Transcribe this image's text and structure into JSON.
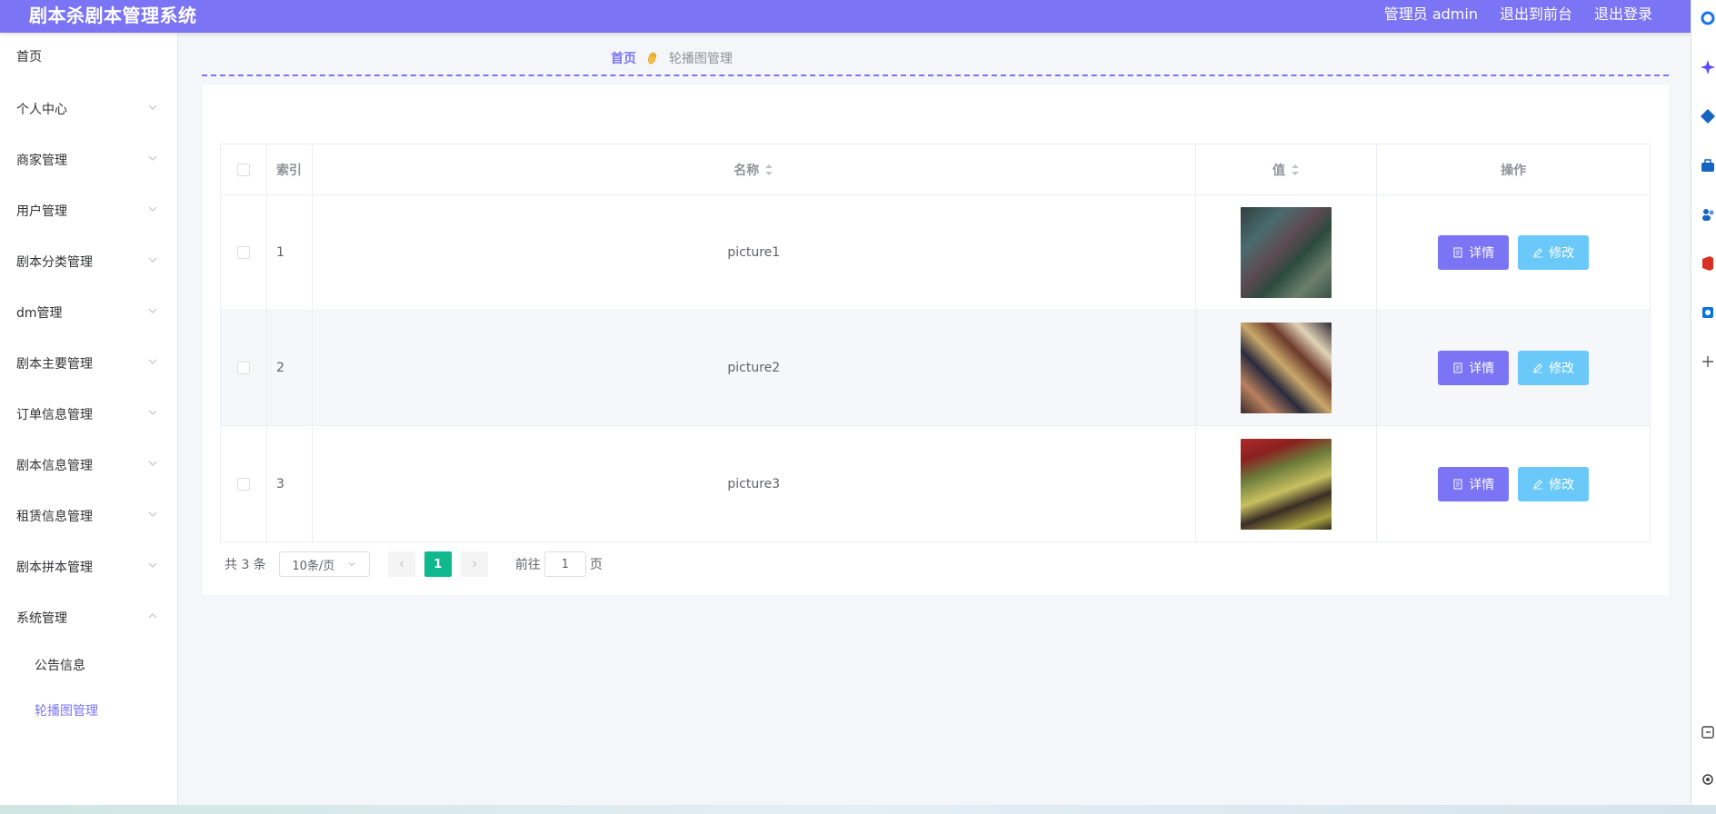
{
  "header": {
    "title": "剧本杀剧本管理系统",
    "admin": "管理员 admin",
    "front": "退出到前台",
    "logout": "退出登录"
  },
  "sidebar": {
    "items": [
      {
        "label": "首页",
        "has_arrow": false
      },
      {
        "label": "个人中心",
        "has_arrow": true
      },
      {
        "label": "商家管理",
        "has_arrow": true
      },
      {
        "label": "用户管理",
        "has_arrow": true
      },
      {
        "label": "剧本分类管理",
        "has_arrow": true
      },
      {
        "label": "dm管理",
        "has_arrow": true
      },
      {
        "label": "剧本主要管理",
        "has_arrow": true
      },
      {
        "label": "订单信息管理",
        "has_arrow": true
      },
      {
        "label": "剧本信息管理",
        "has_arrow": true
      },
      {
        "label": "租赁信息管理",
        "has_arrow": true
      },
      {
        "label": "剧本拼本管理",
        "has_arrow": true
      },
      {
        "label": "系统管理",
        "has_arrow": true,
        "expanded": true
      }
    ],
    "subitems": [
      {
        "label": "公告信息",
        "active": false
      },
      {
        "label": "轮播图管理",
        "active": true
      }
    ]
  },
  "breadcrumb": {
    "home": "首页",
    "current": "轮播图管理"
  },
  "table": {
    "headers": {
      "index": "索引",
      "name": "名称",
      "value": "值",
      "actions": "操作"
    },
    "rows": [
      {
        "index": "1",
        "name": "picture1",
        "image": "thumb1"
      },
      {
        "index": "2",
        "name": "picture2",
        "image": "thumb2"
      },
      {
        "index": "3",
        "name": "picture3",
        "image": "thumb3"
      }
    ],
    "detail_label": "详情",
    "edit_label": "修改"
  },
  "pagination": {
    "total": "共 3 条",
    "page_size": "10条/页",
    "current_page": "1",
    "goto_prefix": "前往",
    "goto_value": "1",
    "goto_suffix": "页"
  },
  "colors": {
    "accent": "#7b74f5",
    "edit": "#6ac9f8",
    "page_active": "#10b98d"
  }
}
